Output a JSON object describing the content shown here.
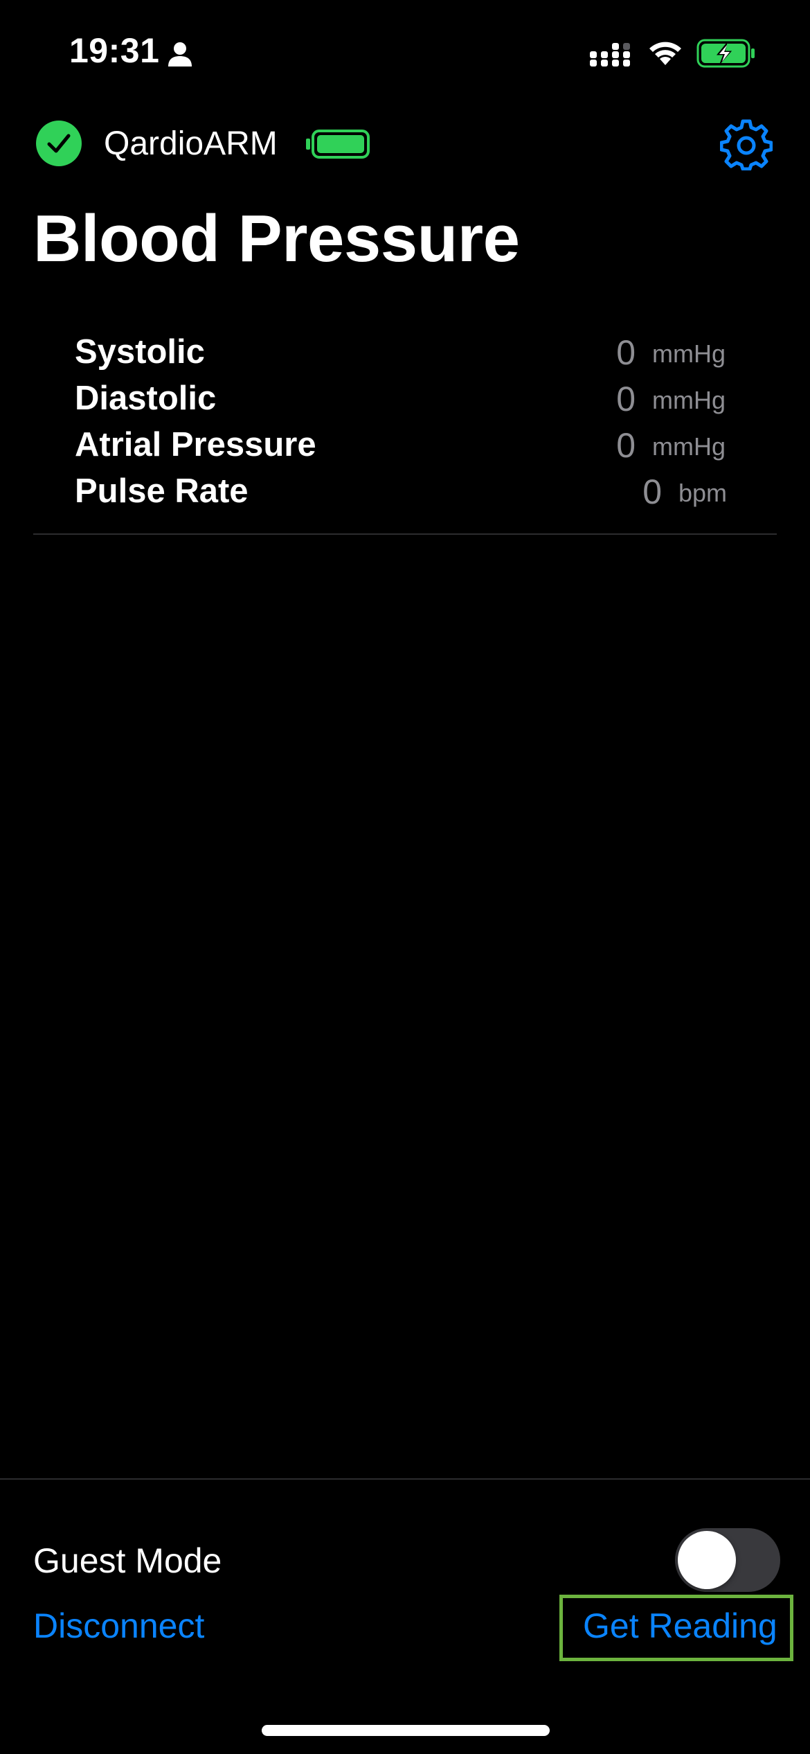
{
  "status_bar": {
    "time": "19:31",
    "icons": [
      "person-icon",
      "signal-icon",
      "wifi-icon",
      "battery-charging-icon"
    ]
  },
  "device": {
    "name": "QardioARM",
    "connected_icon": "checkmark-circle-icon",
    "battery_icon": "battery-full-icon",
    "settings_icon": "gear-icon"
  },
  "page": {
    "title": "Blood Pressure"
  },
  "readings": [
    {
      "label": "Systolic",
      "value": "0",
      "unit": "mmHg"
    },
    {
      "label": "Diastolic",
      "value": "0",
      "unit": "mmHg"
    },
    {
      "label": "Atrial Pressure",
      "value": "0",
      "unit": "mmHg"
    },
    {
      "label": "Pulse Rate",
      "value": "0",
      "unit": "bpm"
    }
  ],
  "bottom": {
    "guest_mode_label": "Guest Mode",
    "guest_mode_on": false,
    "disconnect_label": "Disconnect",
    "get_reading_label": "Get Reading"
  },
  "colors": {
    "background": "#000000",
    "accent_blue": "#0a84ff",
    "connected_green": "#30d158",
    "secondary_text": "#8e8e93",
    "highlight_box": "#6cb33e"
  }
}
